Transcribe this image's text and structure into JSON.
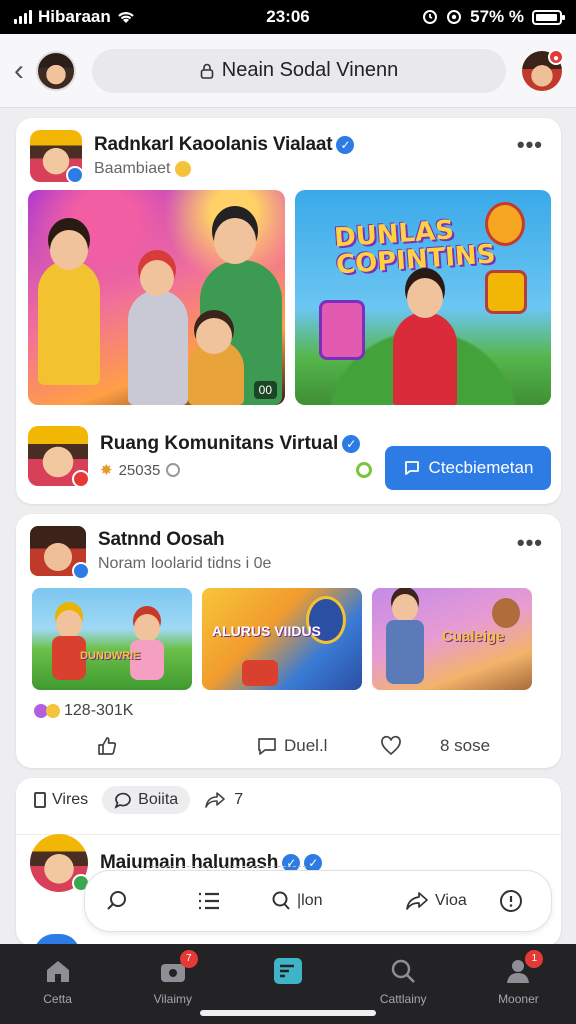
{
  "status_bar": {
    "carrier": "Hibaraan",
    "time": "23:06",
    "battery_text": "57% %"
  },
  "header": {
    "search_label": "Neain Sodal Vinenn"
  },
  "post1": {
    "author": "Radnkarl Kaoolanis Vialaat",
    "subtitle": "Baambiaet",
    "video_duration": "00",
    "game_banner": "DUNLAS COPINTINS",
    "community": {
      "title": "Ruang Komunitans Virtual",
      "count": "25035"
    },
    "cta_label": "Ctecbiemetan"
  },
  "post2": {
    "author": "Satnnd Oosah",
    "subtitle": "Noram Ioolarid tidns i 0e",
    "thumb_titles": [
      "DUNDWRIE",
      "ALURUS VIIDUS",
      "Cualeige"
    ],
    "reactions_count": "128-301K",
    "comment_label": "Duel.l",
    "share_label": "8 sose"
  },
  "post3": {
    "mini_bar": {
      "views_label": "Vires",
      "comment_chip": "Boiita",
      "share_count": "7"
    },
    "author": "Maiumain halumash"
  },
  "comment_bar": {
    "center_label": "|lon",
    "share_label": "Vioa"
  },
  "bottom_nav": [
    {
      "label": "Cetta"
    },
    {
      "label": "Vilaimy",
      "badge": "7"
    },
    {
      "label": ""
    },
    {
      "label": "Cattlainy"
    },
    {
      "label": "Mooner",
      "badge": "1"
    }
  ],
  "colors": {
    "accent": "#2d7be5",
    "badge": "#e53935",
    "nav_bg": "#232326"
  }
}
